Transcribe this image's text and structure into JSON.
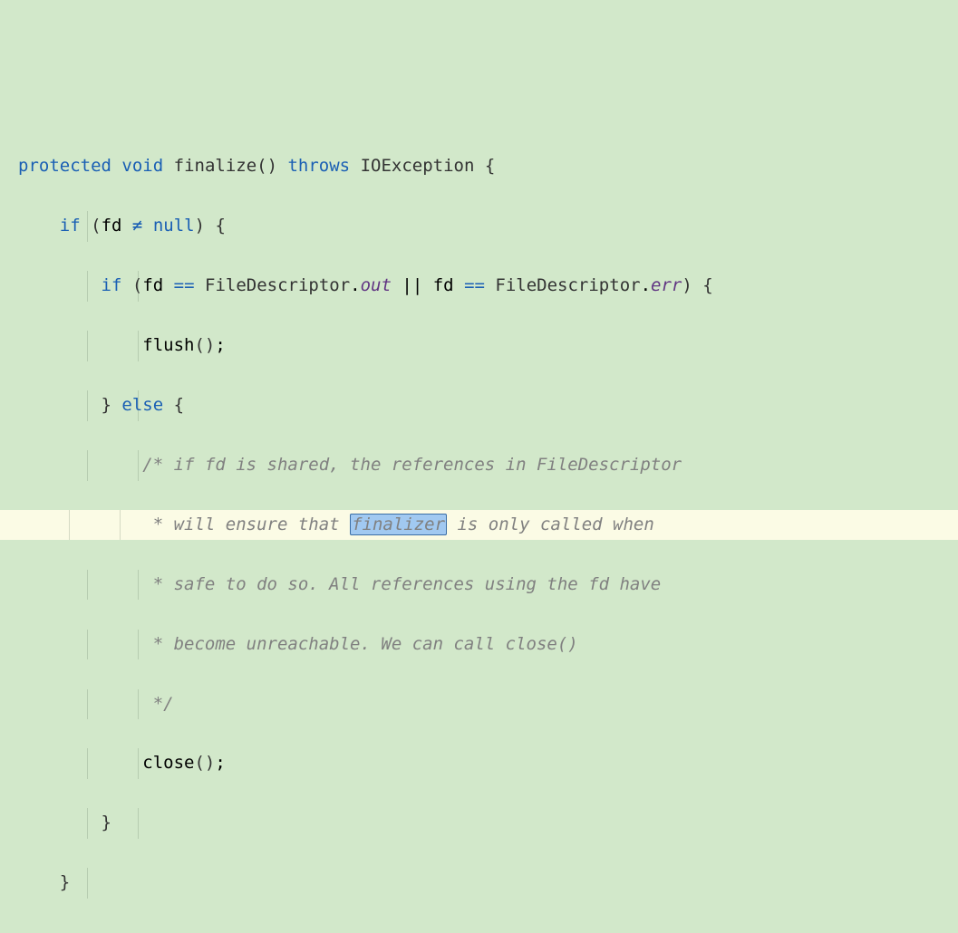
{
  "code": {
    "t_protected": "protected",
    "t_void": "void",
    "t_finalize": "finalize",
    "t_throws": "throws",
    "t_io_exception": "IOException",
    "t_if": "if",
    "t_fd": "fd",
    "t_neq_glyph": "≠",
    "t_null": "null",
    "t_eq_glyph": "==",
    "t_filedescriptor": "FileDescriptor",
    "t_out": "out",
    "t_err": "err",
    "t_or": "||",
    "t_flush": "flush",
    "t_else": "else",
    "t_close": "close",
    "comment1": "/* if fd is shared, the references in FileDescriptor",
    "comment2_a": " * will ensure that ",
    "comment2_hl": "finalizer",
    "comment2_b": " is only called when",
    "comment3": " * safe to do so. All references using the fd have",
    "comment4": " * become unreachable. We can call close()",
    "comment5": " */"
  }
}
